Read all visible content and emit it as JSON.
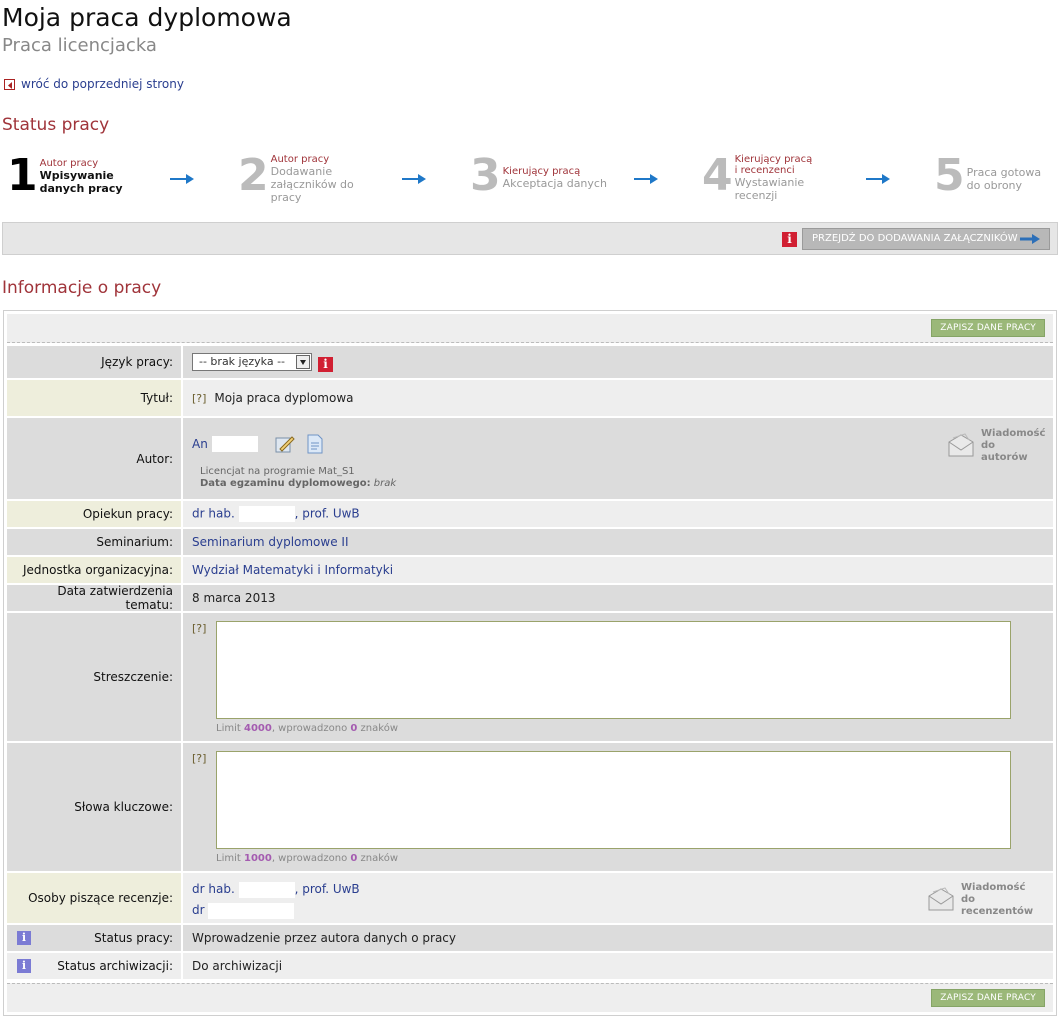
{
  "header": {
    "title": "Moja praca dyplomowa",
    "subtitle": "Praca licencjacka",
    "back_link": "wróć do poprzedniej strony"
  },
  "status": {
    "title": "Status pracy",
    "steps": [
      {
        "num": "1",
        "role": "Autor pracy",
        "label": "Wpisywanie danych pracy",
        "active": true
      },
      {
        "num": "2",
        "role": "Autor pracy",
        "label": "Dodawanie załączników do pracy",
        "active": false
      },
      {
        "num": "3",
        "role": "Kierujący pracą",
        "label": "Akceptacja danych",
        "active": false
      },
      {
        "num": "4",
        "role": "Kierujący pracą i recenzenci",
        "label": "Wystawianie recenzji",
        "active": false
      },
      {
        "num": "5",
        "role": "",
        "label": "Praca gotowa do obrony",
        "active": false
      }
    ],
    "next_button": "PRZEJDŹ DO DODAWANIA ZAŁĄCZNIKÓW"
  },
  "info": {
    "title": "Informacje o pracy",
    "save_label": "ZAPISZ DANE PRACY",
    "language_label": "Język pracy:",
    "language_value": "-- brak języka --",
    "title_label": "Tytuł:",
    "title_value": "Moja praca dyplomowa",
    "help": "[?]",
    "author_label": "Autor:",
    "author_name": "An",
    "author_program": "Licencjat na programie Mat_S1",
    "exam_date_label": "Data egzaminu dyplomowego:",
    "exam_date_value": "brak",
    "message_authors": "Wiadomość do autorów",
    "supervisor_label": "Opiekun pracy:",
    "supervisor_prefix": "dr hab.",
    "supervisor_suffix": ", prof. UwB",
    "seminar_label": "Seminarium:",
    "seminar_value": "Seminarium dyplomowe II",
    "unit_label": "Jednostka organizacyjna:",
    "unit_value": "Wydział Matematyki i Informatyki",
    "approval_label": "Data zatwierdzenia tematu:",
    "approval_value": "8 marca 2013",
    "abstract_label": "Streszczenie:",
    "abstract_limit_prefix": "Limit",
    "abstract_limit": "4000",
    "abstract_mid": ", wprowadzono",
    "abstract_count": "0",
    "abstract_suffix": "znaków",
    "keywords_label": "Słowa kluczowe:",
    "keywords_limit_prefix": "Limit",
    "keywords_limit": "1000",
    "keywords_mid": ", wprowadzono",
    "keywords_count": "0",
    "keywords_suffix": "znaków",
    "reviewers_label": "Osoby piszące recenzje:",
    "reviewer1_prefix": "dr hab.",
    "reviewer1_suffix": ", prof. UwB",
    "reviewer2_prefix": "dr",
    "message_reviewers": "Wiadomość do recenzentów",
    "work_status_label": "Status pracy:",
    "work_status_value": "Wprowadzenie przez autora danych o pracy",
    "archive_status_label": "Status archiwizacji:",
    "archive_status_value": "Do archiwizacji"
  },
  "colors": {
    "accent_red": "#a0343a",
    "link_blue": "#2a3e8f",
    "save_green": "#9bb879",
    "arrow_blue": "#1f78c8"
  }
}
